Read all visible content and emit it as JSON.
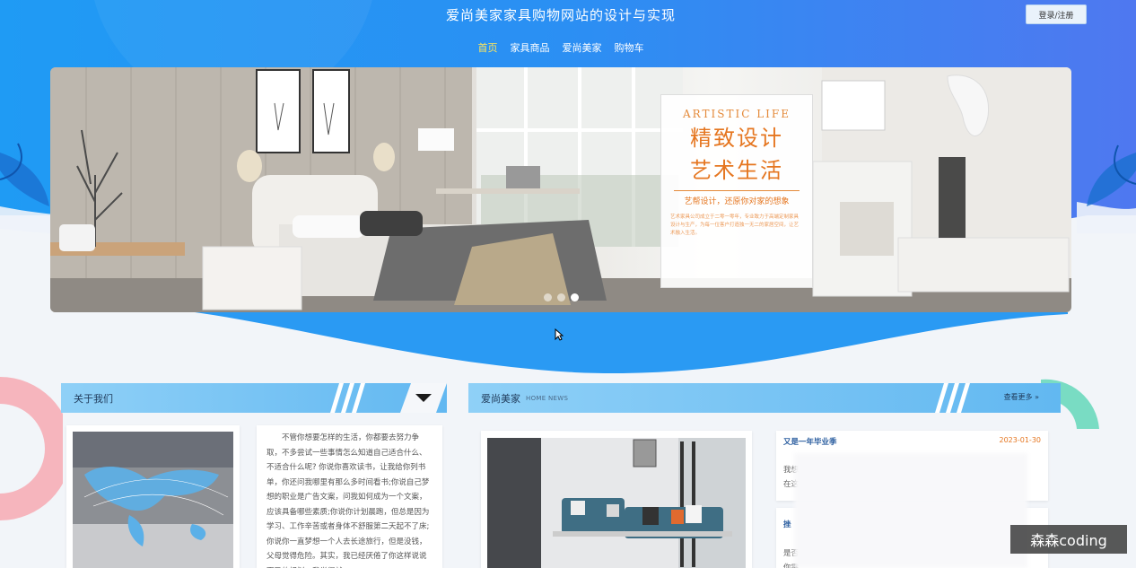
{
  "header": {
    "site_title": "爱尚美家家具购物网站的设计与实现",
    "login_label": "登录/注册"
  },
  "nav": {
    "items": [
      {
        "label": "首页",
        "active": true
      },
      {
        "label": "家具商品",
        "active": false
      },
      {
        "label": "爱尚美家",
        "active": false
      },
      {
        "label": "购物车",
        "active": false
      }
    ]
  },
  "banner": {
    "promo_en": "ARTISTIC LIFE",
    "promo_line1": "精致设计",
    "promo_line2": "艺术生活",
    "promo_sub": "艺帮设计，还原你对家的想象",
    "promo_body": "艺术家具公司成立于二零一零年，专业致力于高端定制家具设计与生产，为每一位客户打造独一无二的家居空间，让艺术融入生活。",
    "slide_count": 3,
    "active_slide": 3
  },
  "about": {
    "title": "关于我们",
    "text": "不管你想要怎样的生活，你都要去努力争取，不多尝试一些事情怎么知道自己适合什么、不适合什么呢? 你说你喜欢读书，让我给你列书单，你还问我哪里有那么多时间看书;你说自己梦想的职业是广告文案，问我如何成为一个文案，应该具备哪些素质;你说你计划晨跑，但总是因为学习、工作辛苦或者身体不舒服第二天起不了床;你说你一直梦想一个人去长途旅行，但是没钱，父母觉得危险。其实，我已经厌倦了你这样说说而已的规划，我觉得就"
  },
  "news": {
    "title": "爱尚美家",
    "subtitle": "HOME NEWS",
    "more_label": "查看更多 »",
    "items": [
      {
        "title": "又是一年毕业季",
        "date": "2023-01-30",
        "snippet": "我想"
      },
      {
        "title": "挫",
        "date": "",
        "snippet": "是否"
      }
    ],
    "snippet_extra": [
      "在这",
      "你需"
    ]
  },
  "watermark": "森森coding",
  "colors": {
    "primary_blue": "#2f8ef0",
    "nav_active": "#ffe65c",
    "accent_orange": "#e57620"
  }
}
